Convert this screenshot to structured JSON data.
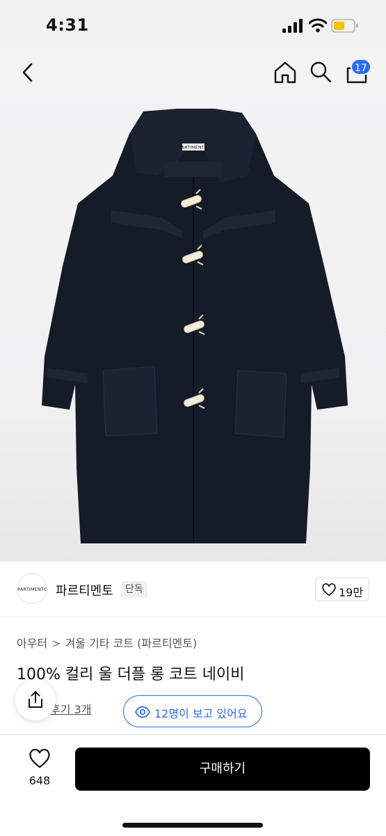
{
  "status_bar": {
    "time": "4:31"
  },
  "nav": {
    "cart_count": "17"
  },
  "brand": {
    "logo_text": "PARTIMENTO",
    "name": "파르티멘토",
    "tag": "단독",
    "likes": "19만"
  },
  "product": {
    "breadcrumb_root": "아우터",
    "breadcrumb_sep": ">",
    "breadcrumb_leaf": "겨울 기타 코트 (파르티멘토)",
    "title": "100% 컬리 울 더플 롱 코트 네이비",
    "reviews": "후기 3개",
    "viewers": "12명이 보고 있어요",
    "coat_label": "PARTIMENTO"
  },
  "bottom": {
    "wish_count": "648",
    "buy_label": "구매하기"
  },
  "colors": {
    "accent": "#2b6bf3",
    "coat": "#141a26",
    "toggle": "#f2ecd8"
  },
  "icons": [
    "back-icon",
    "home-icon",
    "search-icon",
    "shopping-bag-icon",
    "heart-icon",
    "share-icon",
    "eye-icon"
  ]
}
